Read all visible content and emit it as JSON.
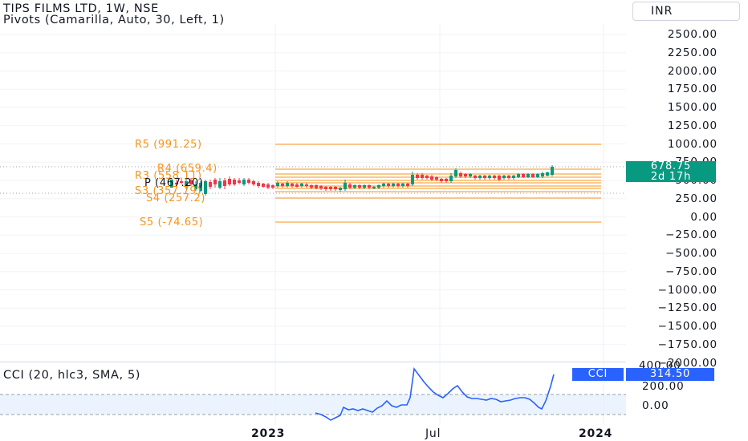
{
  "header": {
    "symbol_title": "TIPS FILMS LTD, 1W, NSE",
    "pivots_label": "Pivots (Camarilla, Auto, 30, Left, 1)",
    "currency_button": "INR"
  },
  "colors": {
    "pivot": "#f7931a",
    "up": "#089981",
    "down": "#f23645",
    "cci_line": "#2962ff",
    "grid": "#f0f3fa"
  },
  "price_axis": {
    "ticks": [
      "2500.00",
      "2250.00",
      "2000.00",
      "1750.00",
      "1500.00",
      "1250.00",
      "1000.00",
      "750.00",
      "500.00",
      "250.00",
      "0.00",
      "−250.00",
      "−500.00",
      "−750.00",
      "−1000.00",
      "−1250.00",
      "−1500.00",
      "−1750.00",
      "−2000.00"
    ]
  },
  "pivots": {
    "r5": "R5 (991.25)",
    "r4": "R4 (659.4)",
    "r3": "R3 (558.11)",
    "p": "P (467.20)",
    "s3": "S3 (357.79)",
    "s4": "S4 (257.2)",
    "s5": "S5 (-74.65)"
  },
  "price_tag": {
    "value": "678.75",
    "countdown": "2d 17h"
  },
  "time_axis": {
    "labels": [
      "2023",
      "Jul",
      "2024"
    ]
  },
  "cci_panel": {
    "title": "CCI (20, hlc3, SMA, 5)",
    "tag_name": "CCI",
    "tag_value": "314.50",
    "ticks": [
      "400.00",
      "200.00",
      "0.00"
    ]
  }
}
